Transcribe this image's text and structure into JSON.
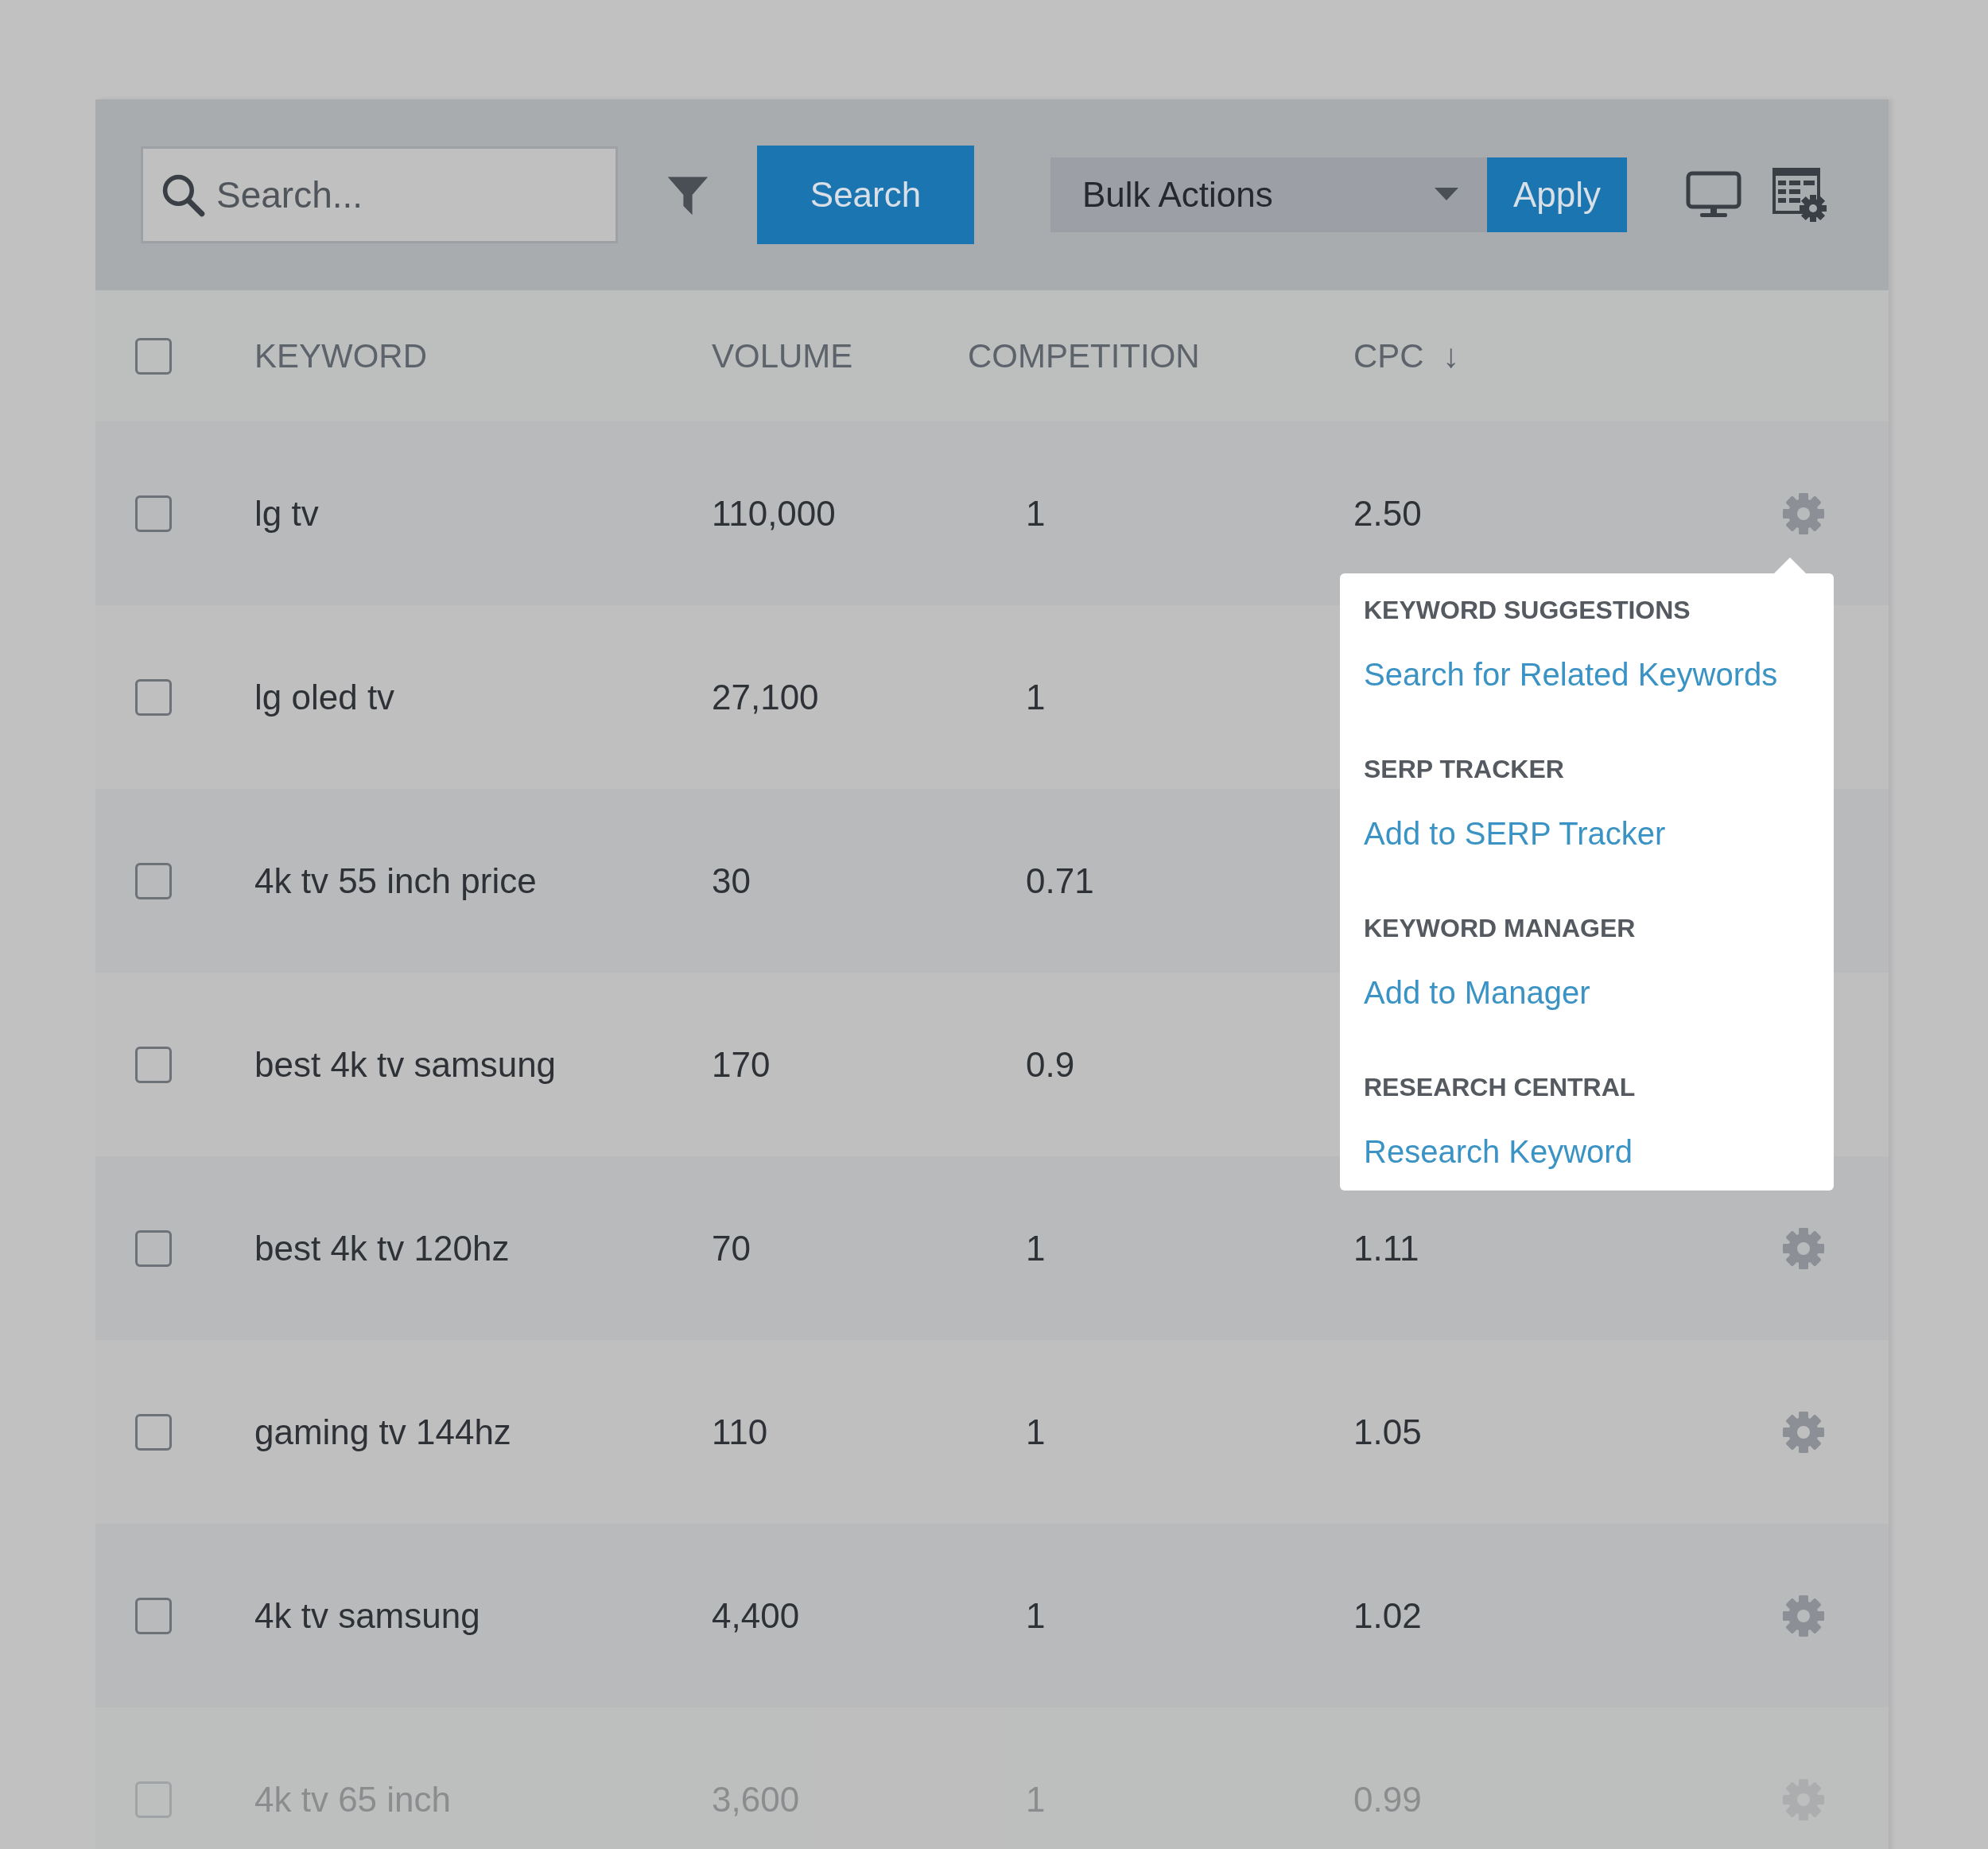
{
  "toolbar": {
    "search": {
      "placeholder": "Search..."
    },
    "search_button": "Search",
    "bulk_actions": {
      "value": "Bulk Actions"
    },
    "apply_button": "Apply"
  },
  "table": {
    "select_all_checked": false,
    "columns": [
      {
        "label": "KEYWORD"
      },
      {
        "label": "VOLUME"
      },
      {
        "label": "COMPETITION"
      },
      {
        "label": "CPC",
        "sort_mark": "↓"
      }
    ],
    "rows": [
      {
        "checked": false,
        "keyword": "lg tv",
        "volume": "110,000",
        "competition": "1",
        "cpc": "2.50",
        "faded": false
      },
      {
        "checked": false,
        "keyword": "lg oled tv",
        "volume": "27,100",
        "competition": "1",
        "faded": false
      },
      {
        "checked": false,
        "keyword": "4k tv 55 inch price",
        "volume": "30",
        "competition": "0.71",
        "faded": false
      },
      {
        "checked": false,
        "keyword": "best 4k tv samsung",
        "volume": "170",
        "competition": "0.9",
        "faded": false
      },
      {
        "checked": false,
        "keyword": "best 4k tv 120hz",
        "volume": "70",
        "competition": "1",
        "cpc": "1.11",
        "faded": false
      },
      {
        "checked": false,
        "keyword": "gaming tv 144hz",
        "volume": "110",
        "competition": "1",
        "cpc": "1.05",
        "faded": false
      },
      {
        "checked": false,
        "keyword": "4k tv samsung",
        "volume": "4,400",
        "competition": "1",
        "cpc": "1.02",
        "faded": false
      },
      {
        "checked": false,
        "keyword": "4k tv 65 inch",
        "volume": "3,600",
        "competition": "1",
        "cpc": "0.99",
        "faded": true
      }
    ]
  },
  "row_menu": {
    "sections": [
      {
        "heading": "KEYWORD SUGGESTIONS",
        "link": "Search for Related Keywords"
      },
      {
        "heading": "SERP TRACKER",
        "link": "Add to SERP Tracker"
      },
      {
        "heading": "KEYWORD MANAGER",
        "link": "Add to Manager"
      },
      {
        "heading": "RESEARCH CENTRAL",
        "link": "Research Keyword"
      }
    ]
  }
}
